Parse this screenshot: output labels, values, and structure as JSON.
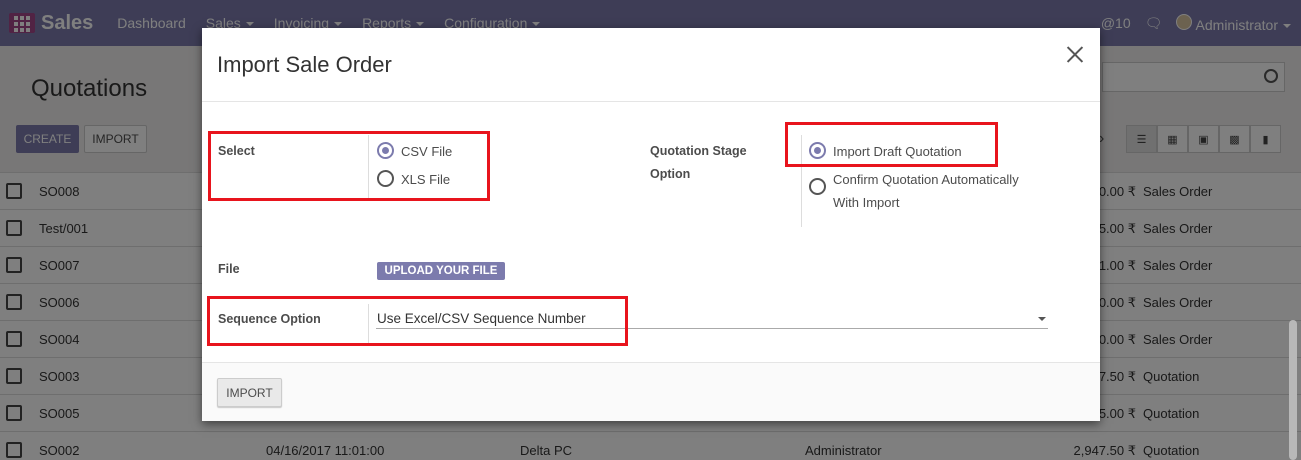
{
  "navbar": {
    "brand": "Sales",
    "menu": [
      {
        "label": "Dashboard",
        "caret": false
      },
      {
        "label": "Sales",
        "caret": true
      },
      {
        "label": "Invoicing",
        "caret": true
      },
      {
        "label": "Reports",
        "caret": true
      },
      {
        "label": "Configuration",
        "caret": true
      }
    ],
    "notifications": "@10",
    "user": "Administrator"
  },
  "page": {
    "title": "Quotations",
    "create_label": "CREATE",
    "import_label": "IMPORT",
    "rows": [
      {
        "ref": "SO008",
        "date": "",
        "customer": "",
        "salesperson": "",
        "amount": "0.00 ₹",
        "status": "Sales Order"
      },
      {
        "ref": "Test/001",
        "date": "",
        "customer": "",
        "salesperson": "",
        "amount": "5.00 ₹",
        "status": "Sales Order"
      },
      {
        "ref": "SO007",
        "date": "",
        "customer": "",
        "salesperson": "",
        "amount": "1.00 ₹",
        "status": "Sales Order"
      },
      {
        "ref": "SO006",
        "date": "",
        "customer": "",
        "salesperson": "",
        "amount": "0.00 ₹",
        "status": "Sales Order"
      },
      {
        "ref": "SO004",
        "date": "",
        "customer": "",
        "salesperson": "",
        "amount": "0.00 ₹",
        "status": "Sales Order"
      },
      {
        "ref": "SO003",
        "date": "",
        "customer": "",
        "salesperson": "",
        "amount": "7.50 ₹",
        "status": "Quotation"
      },
      {
        "ref": "SO005",
        "date": "",
        "customer": "",
        "salesperson": "",
        "amount": "5.00 ₹",
        "status": "Quotation"
      },
      {
        "ref": "SO002",
        "date": "04/16/2017 11:01:00",
        "customer": "Delta PC",
        "salesperson": "Administrator",
        "amount": "2,947.50 ₹",
        "status": "Quotation"
      }
    ]
  },
  "modal": {
    "title": "Import Sale Order",
    "select_label": "Select",
    "file_types": [
      "CSV File",
      "XLS File"
    ],
    "selected_file_type": 0,
    "stage_label_line1": "Quotation Stage",
    "stage_label_line2": "Option",
    "stage_options": [
      "Import Draft Quotation",
      "Confirm Quotation Automatically",
      "With Import"
    ],
    "selected_stage": 0,
    "file_label": "File",
    "upload_label": "UPLOAD YOUR FILE",
    "sequence_label": "Sequence Option",
    "sequence_value": "Use Excel/CSV Sequence Number",
    "import_button": "IMPORT"
  },
  "colors": {
    "navbar": "#7c7bad",
    "accent": "#7c7bad",
    "highlight": "#e8141d"
  }
}
